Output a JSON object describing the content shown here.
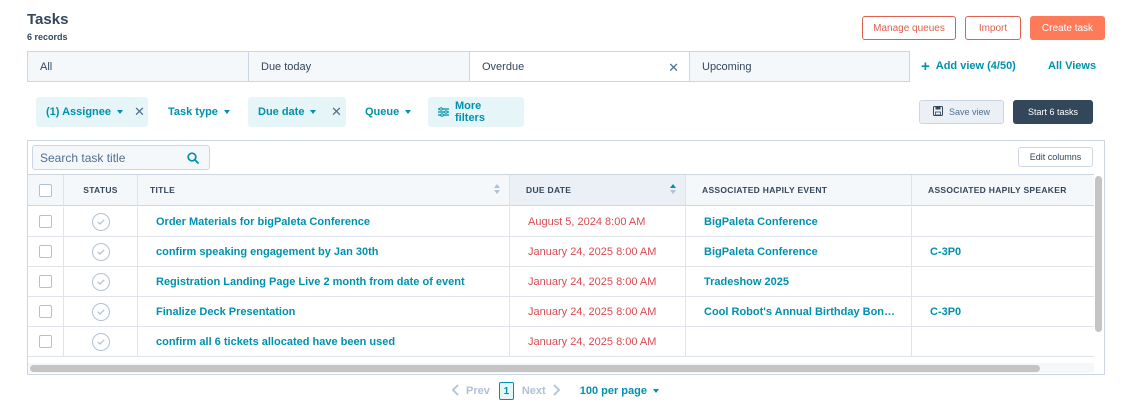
{
  "header": {
    "title": "Tasks",
    "record_count": "6 records"
  },
  "actions": {
    "manage_queues": "Manage queues",
    "import": "Import",
    "create_task": "Create task"
  },
  "views": {
    "tabs": [
      {
        "label": "All"
      },
      {
        "label": "Due today"
      },
      {
        "label": "Overdue"
      },
      {
        "label": "Upcoming"
      }
    ],
    "add_view": "Add view (4/50)",
    "all_views": "All Views"
  },
  "filters": {
    "assignee": "(1) Assignee",
    "task_type": "Task type",
    "due_date": "Due date",
    "queue": "Queue",
    "more_filters": "More filters"
  },
  "toolbar": {
    "save_view": "Save view",
    "start_tasks": "Start 6 tasks"
  },
  "table": {
    "search_placeholder": "Search task title",
    "edit_columns": "Edit columns",
    "columns": {
      "status": "STATUS",
      "title": "TITLE",
      "due_date": "DUE DATE",
      "event": "ASSOCIATED HAPILY EVENT",
      "speaker": "ASSOCIATED HAPILY SPEAKER"
    },
    "rows": [
      {
        "title": "Order Materials for bigPaleta Conference",
        "due": "August 5, 2024 8:00 AM",
        "event": "BigPaleta Conference",
        "speaker": ""
      },
      {
        "title": "confirm speaking engagement by Jan 30th",
        "due": "January 24, 2025 8:00 AM",
        "event": "BigPaleta Conference",
        "speaker": "C-3P0"
      },
      {
        "title": "Registration Landing Page Live 2 month from date of event",
        "due": "January 24, 2025 8:00 AM",
        "event": "Tradeshow 2025",
        "speaker": ""
      },
      {
        "title": "Finalize Deck Presentation",
        "due": "January 24, 2025 8:00 AM",
        "event": "Cool Robot's Annual Birthday Bon…",
        "speaker": "C-3P0"
      },
      {
        "title": "confirm all 6 tickets allocated have been used",
        "due": "January 24, 2025 8:00 AM",
        "event": "",
        "speaker": ""
      }
    ]
  },
  "pagination": {
    "prev": "Prev",
    "page": "1",
    "next": "Next",
    "per_page": "100 per page"
  },
  "colors": {
    "accent": "#0091ae",
    "primary": "#ff7a59",
    "overdue": "#d94c53",
    "dark": "#33475b"
  }
}
